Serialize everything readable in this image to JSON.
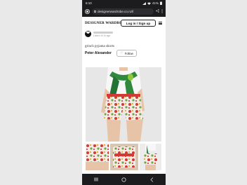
{
  "status_bar": {
    "time": "6:10",
    "battery": "41%",
    "icons": [
      "signal-icon",
      "wifi-icon",
      "battery-icon"
    ]
  },
  "browser": {
    "url": "designerwardrobe.co.nz/l",
    "icons": [
      "home-icon",
      "share-icon",
      "more-icon"
    ]
  },
  "header": {
    "logo": "DESIGNER WARDROBE",
    "login_label": "Log in / Sign up",
    "menu_icon": "hamburger-icon"
  },
  "seller": {
    "listed": "Listed 44 hr ago"
  },
  "listing": {
    "title": "grinch pyjama shorts",
    "designer": "Peter Alexander",
    "follow_label": "Follow"
  },
  "colors": {
    "accent": "#e0245e",
    "background": "#e9e9e9",
    "dark_bar": "#1c1c1e"
  }
}
